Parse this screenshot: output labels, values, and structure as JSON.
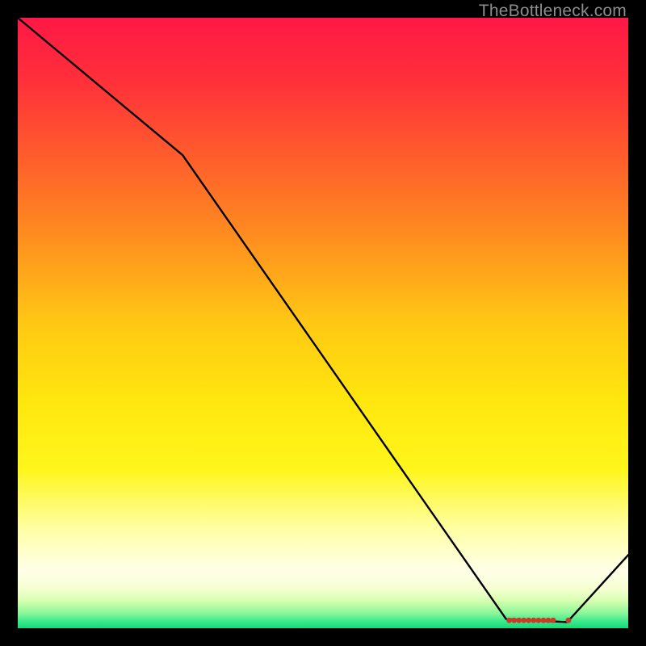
{
  "watermark": "TheBottleneck.com",
  "chart_data": {
    "type": "line",
    "title": "",
    "xlabel": "",
    "ylabel": "",
    "xlim": [
      0,
      100
    ],
    "ylim": [
      0,
      100
    ],
    "series": [
      {
        "name": "curve",
        "x": [
          0,
          27,
          80,
          90,
          100
        ],
        "y": [
          100,
          77.5,
          1.5,
          1,
          12
        ],
        "color": "#000000"
      }
    ],
    "markers": {
      "name": "bottom-cluster",
      "x": [
        80.5,
        81.3,
        82.1,
        82.9,
        83.7,
        84.5,
        85.3,
        86.1,
        86.9,
        87.7,
        90.2
      ],
      "y": [
        1.3,
        1.3,
        1.3,
        1.3,
        1.3,
        1.3,
        1.3,
        1.3,
        1.3,
        1.3,
        1.3
      ],
      "color": "#cc3a2a"
    },
    "gradient_stops": [
      {
        "offset": 0.0,
        "color": "#ff1846"
      },
      {
        "offset": 0.1,
        "color": "#ff2f3a"
      },
      {
        "offset": 0.22,
        "color": "#ff5a2d"
      },
      {
        "offset": 0.35,
        "color": "#ff8a20"
      },
      {
        "offset": 0.5,
        "color": "#ffc814"
      },
      {
        "offset": 0.63,
        "color": "#ffe70e"
      },
      {
        "offset": 0.74,
        "color": "#fff61c"
      },
      {
        "offset": 0.84,
        "color": "#ffffa8"
      },
      {
        "offset": 0.905,
        "color": "#ffffe8"
      },
      {
        "offset": 0.935,
        "color": "#f6ffd2"
      },
      {
        "offset": 0.955,
        "color": "#d6ffb0"
      },
      {
        "offset": 0.975,
        "color": "#8cf79a"
      },
      {
        "offset": 0.99,
        "color": "#34e889"
      },
      {
        "offset": 1.0,
        "color": "#14d977"
      }
    ]
  }
}
